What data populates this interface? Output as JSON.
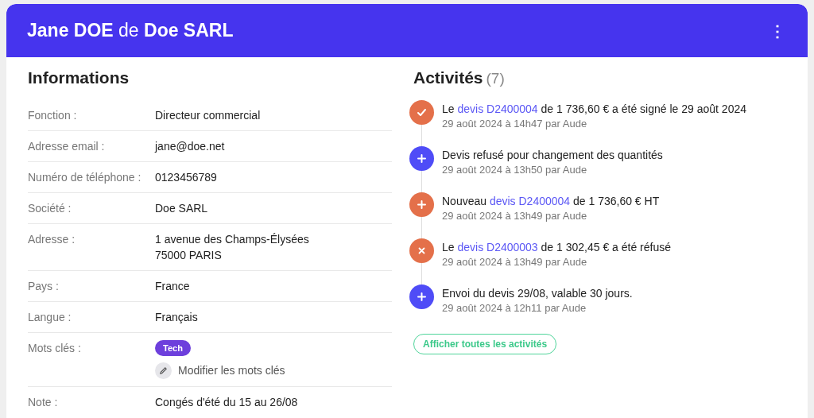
{
  "header": {
    "title": "**Jane DOE** de **Doe SARL**",
    "menu_icon": "⋮"
  },
  "informations": {
    "title": "Informations",
    "rows": [
      {
        "kind": "text",
        "label": "Fonction :",
        "value": "Directeur commercial"
      },
      {
        "kind": "text",
        "label": "Adresse email :",
        "value": "jane@doe.net"
      },
      {
        "kind": "text",
        "label": "Numéro de téléphone :",
        "value": "0123456789"
      },
      {
        "kind": "text",
        "label": "Société :",
        "value": "Doe SARL"
      },
      {
        "kind": "lines",
        "label": "Adresse :",
        "lines": [
          "1 avenue des Champs-Élysées",
          "75000 PARIS"
        ]
      },
      {
        "kind": "text",
        "label": "Pays :",
        "value": "France"
      },
      {
        "kind": "text",
        "label": "Langue :",
        "value": "Français"
      },
      {
        "kind": "tags",
        "label": "Mots clés :",
        "tags": [
          {
            "label": "Tech",
            "color": "#6d3fdc"
          }
        ],
        "edit_label": "Modifier les mots clés"
      },
      {
        "kind": "text",
        "label": "Note :",
        "value": "Congés d'été du 15 au 26/08"
      }
    ]
  },
  "activities": {
    "title": "Activités",
    "count": "(7)",
    "items": [
      {
        "kind": "check",
        "color": "#e4704a",
        "before": "Le ",
        "link": "devis D2400004",
        "after": " de 1 736,60 € a été signé le 29 août 2024",
        "meta": "29 août 2024 à 14h47 par Aude"
      },
      {
        "kind": "plus",
        "color": "#4f4cf7",
        "before": "Devis refusé pour changement des quantités",
        "meta": "29 août 2024 à 13h50 par Aude"
      },
      {
        "kind": "plus",
        "color": "#e4704a",
        "before": "Nouveau ",
        "link": "devis D2400004",
        "after": " de 1 736,60 € HT",
        "meta": "29 août 2024 à 13h49 par Aude"
      },
      {
        "kind": "cross",
        "color": "#e4704a",
        "before": "Le ",
        "link": "devis D2400003",
        "after": " de 1 302,45 € a été réfusé",
        "meta": "29 août 2024 à 13h49 par Aude"
      },
      {
        "kind": "plus",
        "color": "#4f4cf7",
        "before": "Envoi du devis 29/08, valable 30 jours.",
        "meta": "29 août 2024 à 12h11 par Aude"
      }
    ],
    "show_all": "Afficher toutes les activités"
  }
}
